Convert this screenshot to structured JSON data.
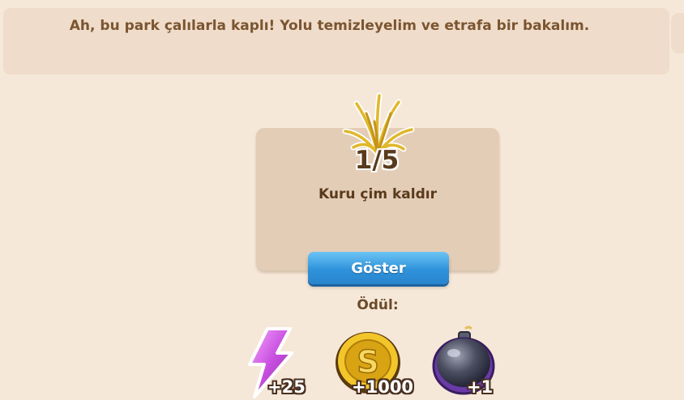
{
  "dialog": {
    "text": "Ah, bu park çalılarla kaplı! Yolu temizleyelim ve etrafa bir bakalım."
  },
  "task": {
    "icon": "dry-grass-icon",
    "progress": "1/5",
    "label": "Kuru çim kaldır",
    "show_button": "Göster"
  },
  "rewards": {
    "title": "Ödül:",
    "items": [
      {
        "icon": "energy-bolt-icon",
        "amount": "+25",
        "color": "#c84fe0"
      },
      {
        "icon": "gold-coin-icon",
        "amount": "+1000",
        "color": "#e8b820"
      },
      {
        "icon": "bomb-icon",
        "amount": "+1",
        "color": "#8a4fc0"
      }
    ]
  }
}
